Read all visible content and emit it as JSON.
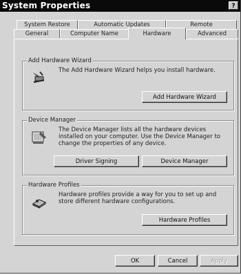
{
  "window": {
    "title": "System Properties",
    "help_label": "?"
  },
  "tabs": {
    "row1": [
      "System Restore",
      "Automatic Updates",
      "Remote"
    ],
    "row2": [
      "General",
      "Computer Name",
      "Hardware",
      "Advanced"
    ]
  },
  "add_hardware": {
    "legend": "Add Hardware Wizard",
    "description": "The Add Hardware Wizard helps you install hardware.",
    "button": "Add Hardware Wizard"
  },
  "device_manager": {
    "legend": "Device Manager",
    "description": "The Device Manager lists all the hardware devices installed on your computer. Use the Device Manager to change the properties of any device.",
    "driver_signing_button": "Driver Signing",
    "device_manager_button": "Device Manager"
  },
  "hardware_profiles": {
    "legend": "Hardware Profiles",
    "description": "Hardware profiles provide a way for you to set up and store different hardware configurations.",
    "button": "Hardware Profiles"
  },
  "footer": {
    "ok": "OK",
    "cancel": "Cancel",
    "apply": "Apply"
  }
}
